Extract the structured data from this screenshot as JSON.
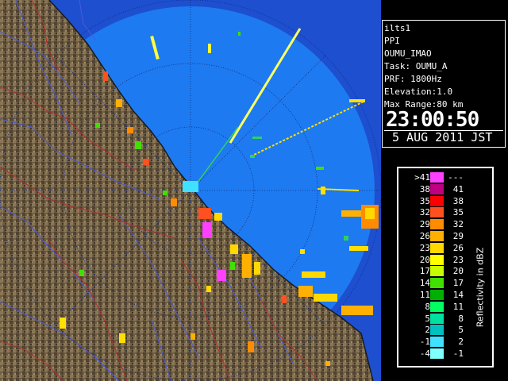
{
  "info": {
    "site": "ilts1",
    "scan_mode": "PPI",
    "radar_name": "OUMU_IMAO",
    "task": "Task: OUMU_A",
    "prf": "PRF: 1800Hz",
    "elevation": "Elevation:1.0",
    "max_range": "Max Range:80 km",
    "time": "23:00:50",
    "date": "5 AUG 2011 JST"
  },
  "legend": {
    "unit": "Reflectivity in dBZ",
    "rows": [
      {
        "lo": ">41",
        "hi": "---",
        "color": "#ff40ff"
      },
      {
        "lo": "38",
        "hi": "41",
        "color": "#c00080"
      },
      {
        "lo": "35",
        "hi": "38",
        "color": "#ff0000"
      },
      {
        "lo": "32",
        "hi": "35",
        "color": "#ff5020"
      },
      {
        "lo": "29",
        "hi": "32",
        "color": "#ff8c00"
      },
      {
        "lo": "26",
        "hi": "29",
        "color": "#ffb000"
      },
      {
        "lo": "23",
        "hi": "26",
        "color": "#ffd800"
      },
      {
        "lo": "20",
        "hi": "23",
        "color": "#ffff00"
      },
      {
        "lo": "17",
        "hi": "20",
        "color": "#c8ff00"
      },
      {
        "lo": "14",
        "hi": "17",
        "color": "#40e000"
      },
      {
        "lo": "11",
        "hi": "14",
        "color": "#00b000"
      },
      {
        "lo": "8",
        "hi": "11",
        "color": "#00ff60"
      },
      {
        "lo": "5",
        "hi": "8",
        "color": "#00e0a0"
      },
      {
        "lo": "2",
        "hi": "5",
        "color": "#00c0c0"
      },
      {
        "lo": "-1",
        "hi": "2",
        "color": "#40e0ff"
      },
      {
        "lo": "-4",
        "hi": "-1",
        "color": "#80ffff"
      }
    ]
  },
  "map": {
    "colors": {
      "sea": "#1e7af0",
      "sea_outer": "#1d4fcf",
      "land": "#6a5a40",
      "rivers": "#4a5cd8",
      "borders": "#b03030",
      "range_rings": "#0a2a80"
    }
  }
}
